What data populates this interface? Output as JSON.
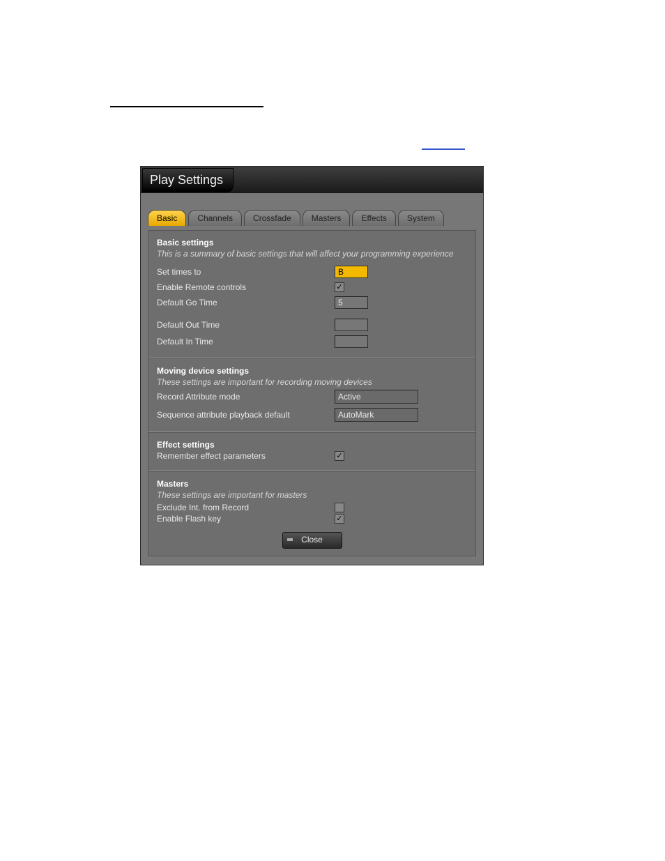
{
  "dialog": {
    "title": "Play Settings",
    "tabs": [
      "Basic",
      "Channels",
      "Crossfade",
      "Masters",
      "Effects",
      "System"
    ],
    "active_tab": 0,
    "close_label": "Close"
  },
  "basic": {
    "title": "Basic settings",
    "desc": "This is a summary of basic settings that will affect your programming experience",
    "set_times_label": "Set times to",
    "set_times_value": "B",
    "enable_remote_label": "Enable Remote controls",
    "enable_remote_checked": true,
    "go_time_label": "Default Go Time",
    "go_time_value": "5",
    "out_time_label": "Default Out Time",
    "out_time_value": "",
    "in_time_label": "Default In Time",
    "in_time_value": ""
  },
  "moving": {
    "title": "Moving device settings",
    "desc": "These settings are important for recording moving devices",
    "record_mode_label": "Record Attribute mode",
    "record_mode_value": "Active",
    "seq_label": "Sequence attribute playback default",
    "seq_value": "AutoMark"
  },
  "effect": {
    "title": "Effect settings",
    "remember_label": "Remember effect parameters",
    "remember_checked": true
  },
  "masters": {
    "title": "Masters",
    "desc": "These settings are important for masters",
    "exclude_label": "Exclude Int. from Record",
    "exclude_checked": false,
    "flash_label": "Enable Flash key",
    "flash_checked": true
  }
}
